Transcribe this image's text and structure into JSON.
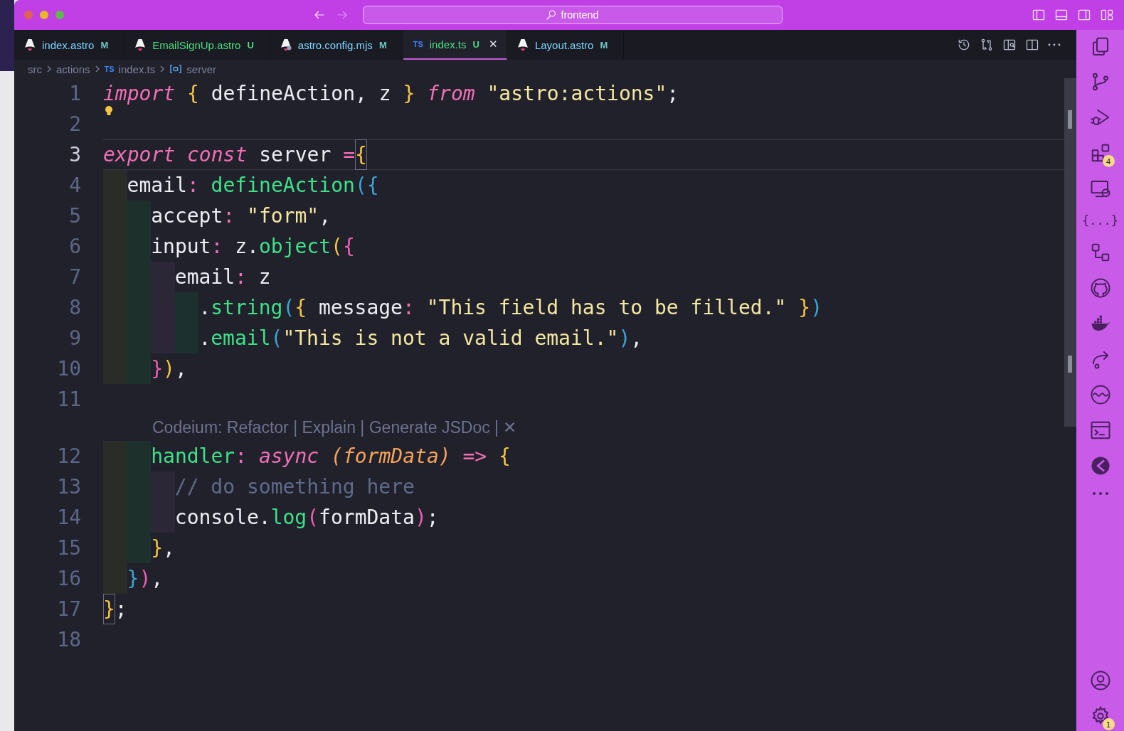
{
  "titlebar": {
    "search": {
      "value": "frontend"
    },
    "layout_buttons": [
      {
        "kind": "sidebar-left"
      },
      {
        "kind": "panel"
      },
      {
        "kind": "sidebar-right"
      },
      {
        "kind": "customize"
      }
    ]
  },
  "tabs": [
    {
      "label": "index.astro",
      "status": "M",
      "kind": "astro",
      "modified": true,
      "selected": false
    },
    {
      "label": "EmailSignUp.astro",
      "status": "U",
      "kind": "astro",
      "modified": false,
      "selected": false
    },
    {
      "label": "astro.config.mjs",
      "status": "M",
      "kind": "config",
      "modified": true,
      "selected": false
    },
    {
      "label": "index.ts",
      "status": "U",
      "kind": "ts",
      "icon_text": "TS",
      "modified": false,
      "selected": true,
      "close": "✕"
    },
    {
      "label": "Layout.astro",
      "status": "M",
      "kind": "astro",
      "modified": true,
      "selected": false
    }
  ],
  "editor_actions": [
    {
      "kind": "history"
    },
    {
      "kind": "compare"
    },
    {
      "kind": "preview"
    },
    {
      "kind": "split"
    },
    {
      "kind": "more"
    }
  ],
  "breadcrumb": [
    {
      "text": "src",
      "kind": "folder"
    },
    {
      "text": "actions",
      "kind": "folder"
    },
    {
      "text": "index.ts",
      "kind": "ts",
      "icon_text": "TS"
    },
    {
      "text": "server",
      "kind": "symbol"
    }
  ],
  "lines": [
    {
      "kind": "code",
      "number": "1",
      "current": false,
      "tokens": [
        {
          "kind": "kw",
          "text": "import"
        },
        {
          "kind": "b1",
          "text": " {"
        },
        {
          "kind": "txt",
          "text": " defineAction, z "
        },
        {
          "kind": "b1",
          "text": "}"
        },
        {
          "kind": "kw",
          "text": " from"
        },
        {
          "kind": "str",
          "text": " \"astro:actions\""
        },
        {
          "kind": "txt",
          "text": ";"
        }
      ]
    },
    {
      "kind": "code",
      "number": "2",
      "current": false,
      "lightbulb": true
    },
    {
      "kind": "code",
      "number": "3",
      "current": true,
      "tokens": [
        {
          "kind": "kw",
          "text": "export"
        },
        {
          "kind": "kw",
          "text": " const"
        },
        {
          "kind": "txt",
          "text": " server "
        },
        {
          "kind": "op",
          "text": "="
        },
        {
          "kind": "match",
          "text": "{"
        }
      ]
    },
    {
      "kind": "code",
      "number": "4",
      "current": false,
      "tokens": [
        {
          "kind": "txt",
          "text": "  email"
        },
        {
          "kind": "op",
          "text": ":"
        },
        {
          "kind": "fn",
          "text": " defineAction"
        },
        {
          "kind": "b3",
          "text": "({"
        }
      ]
    },
    {
      "kind": "code",
      "number": "5",
      "current": false,
      "tokens": [
        {
          "kind": "txt",
          "text": "    accept"
        },
        {
          "kind": "op",
          "text": ":"
        },
        {
          "kind": "str",
          "text": " \"form\""
        },
        {
          "kind": "txt",
          "text": ","
        }
      ]
    },
    {
      "kind": "code",
      "number": "6",
      "current": false,
      "tokens": [
        {
          "kind": "txt",
          "text": "    input"
        },
        {
          "kind": "op",
          "text": ":"
        },
        {
          "kind": "txt",
          "text": " z."
        },
        {
          "kind": "fn",
          "text": "object"
        },
        {
          "kind": "b1",
          "text": "("
        },
        {
          "kind": "b2",
          "text": "{"
        }
      ]
    },
    {
      "kind": "code",
      "number": "7",
      "current": false,
      "tokens": [
        {
          "kind": "txt",
          "text": "      email"
        },
        {
          "kind": "op",
          "text": ":"
        },
        {
          "kind": "txt",
          "text": " z"
        }
      ]
    },
    {
      "kind": "code",
      "number": "8",
      "current": false,
      "tokens": [
        {
          "kind": "txt",
          "text": "        ."
        },
        {
          "kind": "fn",
          "text": "string"
        },
        {
          "kind": "b3",
          "text": "("
        },
        {
          "kind": "b1",
          "text": "{"
        },
        {
          "kind": "txt",
          "text": " message"
        },
        {
          "kind": "op",
          "text": ":"
        },
        {
          "kind": "str",
          "text": " \"This field has to be filled.\""
        },
        {
          "kind": "b1",
          "text": " }"
        },
        {
          "kind": "b3",
          "text": ")"
        }
      ]
    },
    {
      "kind": "code",
      "number": "9",
      "current": false,
      "tokens": [
        {
          "kind": "txt",
          "text": "        ."
        },
        {
          "kind": "fn",
          "text": "email"
        },
        {
          "kind": "b3",
          "text": "("
        },
        {
          "kind": "str",
          "text": "\"This is not a valid email.\""
        },
        {
          "kind": "b3",
          "text": ")"
        },
        {
          "kind": "txt",
          "text": ","
        }
      ]
    },
    {
      "kind": "code",
      "number": "10",
      "current": false,
      "tokens": [
        {
          "kind": "b2",
          "text": "    }"
        },
        {
          "kind": "b1",
          "text": ")"
        },
        {
          "kind": "txt",
          "text": ","
        }
      ]
    },
    {
      "kind": "code",
      "number": "11",
      "current": false
    },
    {
      "kind": "lens",
      "text": "Codeium: Refactor | Explain | Generate JSDoc |",
      "close": "✕"
    },
    {
      "kind": "code",
      "number": "12",
      "current": false,
      "tokens": [
        {
          "kind": "fn",
          "text": "    handler"
        },
        {
          "kind": "op",
          "text": ":"
        },
        {
          "kind": "kw",
          "text": " async"
        },
        {
          "kind": "pm",
          "text": " (formData)"
        },
        {
          "kind": "op",
          "text": " =>"
        },
        {
          "kind": "b1",
          "text": " {"
        }
      ]
    },
    {
      "kind": "code",
      "number": "13",
      "current": false,
      "tokens": [
        {
          "kind": "cm",
          "text": "      // do something here"
        }
      ]
    },
    {
      "kind": "code",
      "number": "14",
      "current": false,
      "tokens": [
        {
          "kind": "txt",
          "text": "      console."
        },
        {
          "kind": "fn",
          "text": "log"
        },
        {
          "kind": "b2",
          "text": "("
        },
        {
          "kind": "txt",
          "text": "formData"
        },
        {
          "kind": "b2",
          "text": ")"
        },
        {
          "kind": "txt",
          "text": ";"
        }
      ]
    },
    {
      "kind": "code",
      "number": "15",
      "current": false,
      "tokens": [
        {
          "kind": "b1",
          "text": "    }"
        },
        {
          "kind": "txt",
          "text": ","
        }
      ]
    },
    {
      "kind": "code",
      "number": "16",
      "current": false,
      "tokens": [
        {
          "kind": "b3",
          "text": "  }"
        },
        {
          "kind": "b2",
          "text": ")"
        },
        {
          "kind": "txt",
          "text": ","
        }
      ]
    },
    {
      "kind": "code",
      "number": "17",
      "current": false,
      "tokens": [
        {
          "kind": "match",
          "text": "}"
        },
        {
          "kind": "txt",
          "text": ";"
        }
      ]
    },
    {
      "kind": "code",
      "number": "18",
      "current": false
    }
  ],
  "activity_top": [
    {
      "kind": "files"
    },
    {
      "kind": "branch"
    },
    {
      "kind": "debug"
    },
    {
      "kind": "extensions",
      "badge": "4"
    },
    {
      "kind": "remote"
    },
    {
      "kind": "braces",
      "glyph": "{...}"
    },
    {
      "kind": "tree"
    },
    {
      "kind": "cat"
    },
    {
      "kind": "whale"
    },
    {
      "kind": "share"
    },
    {
      "kind": "wave"
    },
    {
      "kind": "terminal"
    },
    {
      "kind": "halfcircle"
    },
    {
      "kind": "more"
    }
  ],
  "activity_bottom": [
    {
      "kind": "account"
    },
    {
      "kind": "gear",
      "badge": "1"
    }
  ]
}
